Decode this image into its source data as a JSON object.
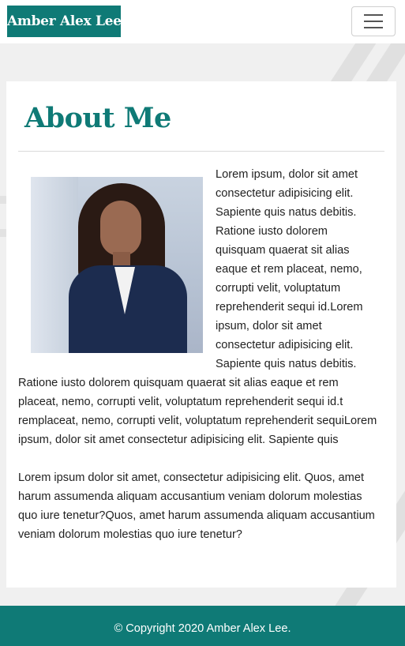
{
  "navbar": {
    "brand": "Amber Alex Lee",
    "menu_icon": "hamburger-menu-icon"
  },
  "about": {
    "title": "About Me",
    "photo_alt": "portrait",
    "paragraph1": "Lorem ipsum, dolor sit amet consectetur adipisicing elit. Sapiente quis natus debitis. Ratione iusto dolorem quisquam quaerat sit alias eaque et rem placeat, nemo, corrupti velit, voluptatum reprehenderit sequi id.Lorem ipsum, dolor sit amet consectetur adipisicing elit. Sapiente quis natus debitis. Ratione iusto dolorem quisquam quaerat sit alias eaque et rem placeat, nemo, corrupti velit, voluptatum reprehenderit sequi id.t remplaceat, nemo, corrupti velit, voluptatum reprehenderit sequiLorem ipsum, dolor sit amet consectetur adipisicing elit. Sapiente quis",
    "paragraph2": "Lorem ipsum dolor sit amet, consectetur adipisicing elit. Quos, amet harum assumenda aliquam accusantium veniam dolorum molestias quo iure tenetur?Quos, amet harum assumenda aliquam accusantium veniam dolorum molestias quo iure tenetur?"
  },
  "footer": {
    "copyright": "© Copyright 2020 Amber Alex Lee."
  },
  "colors": {
    "brand": "#0f7a76",
    "background": "#f0f0f0"
  }
}
